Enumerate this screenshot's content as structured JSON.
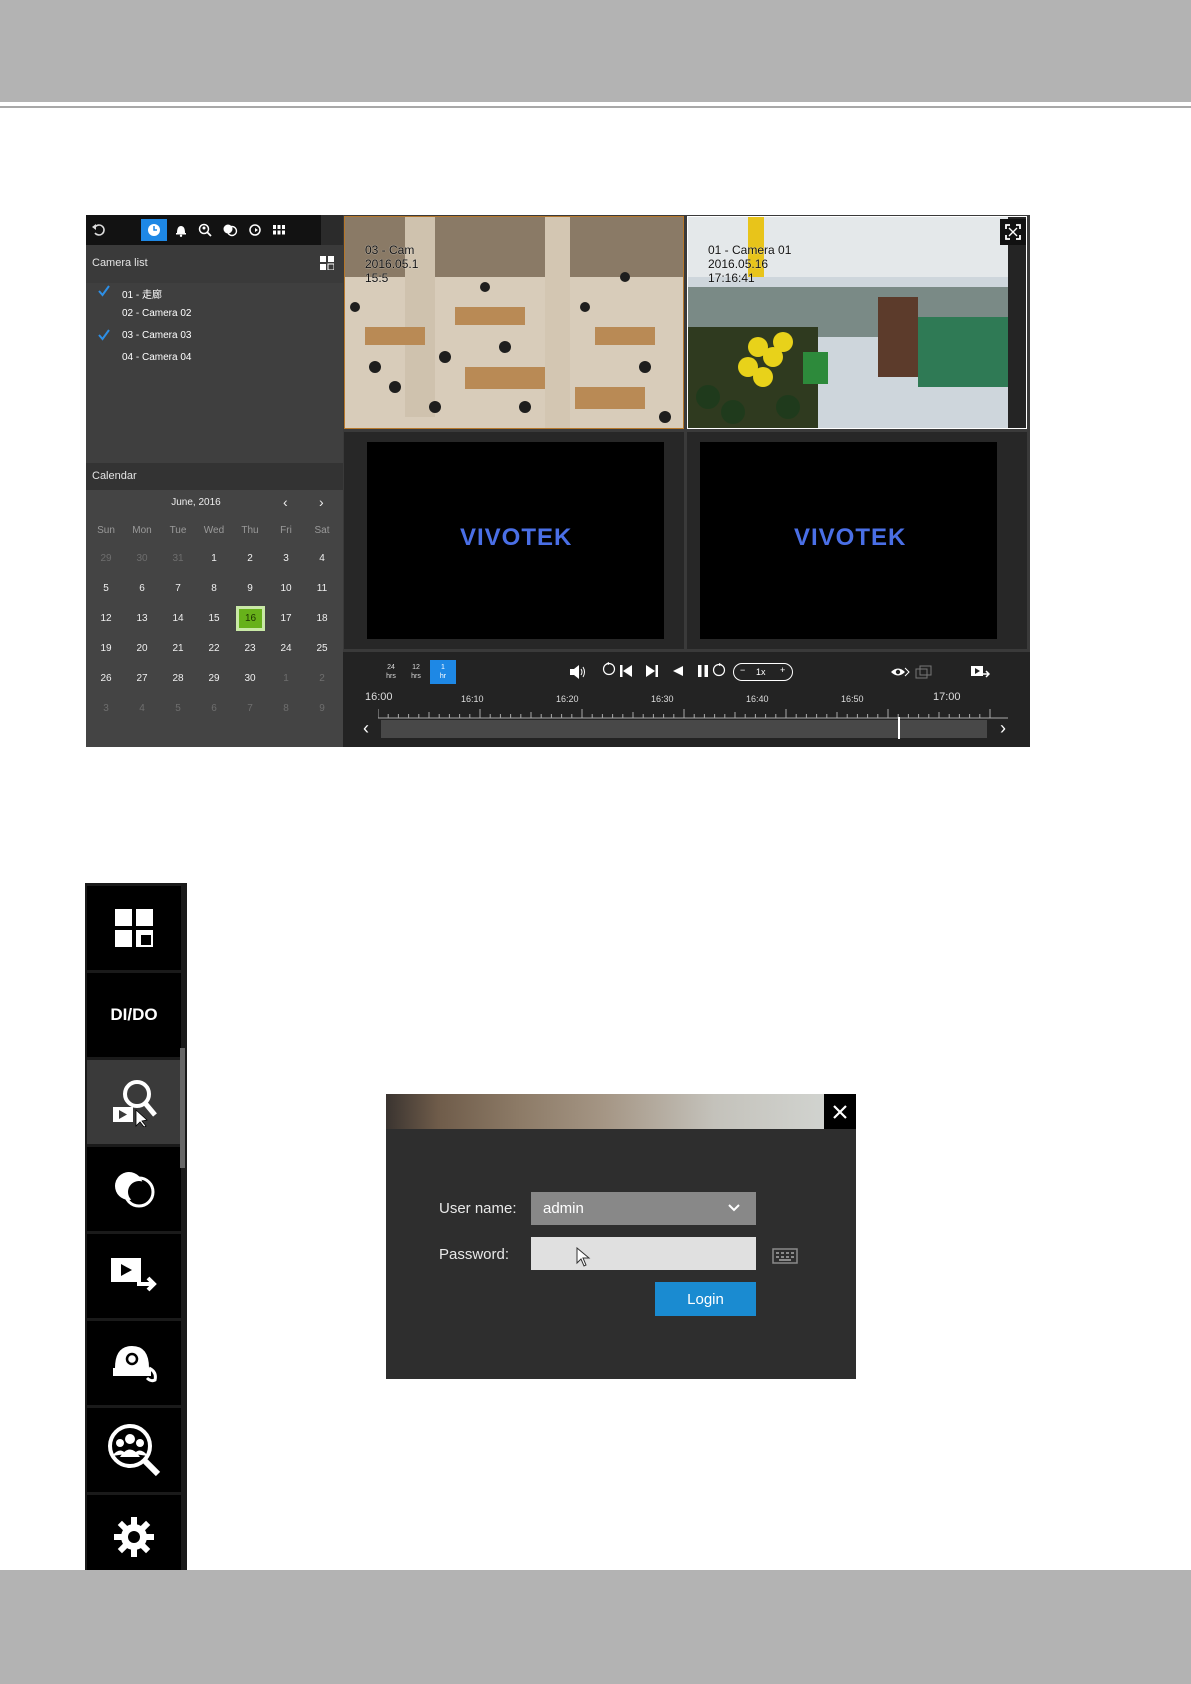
{
  "app": {
    "camera_list_title": "Camera list",
    "cameras": [
      {
        "label": "01 - 走廊",
        "checked": true
      },
      {
        "label": "02 - Camera 02",
        "checked": false
      },
      {
        "label": "03 - Camera 03",
        "checked": true
      },
      {
        "label": "04 - Camera 04",
        "checked": false
      }
    ],
    "calendar_title": "Calendar",
    "month_label": "June, 2016",
    "weekdays": [
      "Sun",
      "Mon",
      "Tue",
      "Wed",
      "Thu",
      "Fri",
      "Sat"
    ],
    "weeks": [
      [
        "29",
        "30",
        "31",
        "1",
        "2",
        "3",
        "4"
      ],
      [
        "5",
        "6",
        "7",
        "8",
        "9",
        "10",
        "11"
      ],
      [
        "12",
        "13",
        "14",
        "15",
        "16",
        "17",
        "18"
      ],
      [
        "19",
        "20",
        "21",
        "22",
        "23",
        "24",
        "25"
      ],
      [
        "26",
        "27",
        "28",
        "29",
        "30",
        "1",
        "2"
      ],
      [
        "3",
        "4",
        "5",
        "6",
        "7",
        "8",
        "9"
      ]
    ],
    "selected_day": "16",
    "tiles": {
      "t1": {
        "name": "03 - Cam",
        "date": "2016.05.1",
        "time": "15:5"
      },
      "t2": {
        "name": "01 - Camera 01",
        "date": "2016.05.16",
        "time": "17:16:41"
      },
      "logo": "VIVOTEK"
    },
    "scale": [
      {
        "top": "24",
        "bottom": "hrs"
      },
      {
        "top": "12",
        "bottom": "hrs"
      },
      {
        "top": "1",
        "bottom": "hr"
      }
    ],
    "speed": "1x",
    "ticks": [
      "16:00",
      "16:10",
      "16:20",
      "16:30",
      "16:40",
      "16:50",
      "17:00"
    ]
  },
  "sidemenu": {
    "dido_label": "DI/DO"
  },
  "login": {
    "username_label": "User name:",
    "username_value": "admin",
    "password_label": "Password:",
    "login_button": "Login"
  }
}
